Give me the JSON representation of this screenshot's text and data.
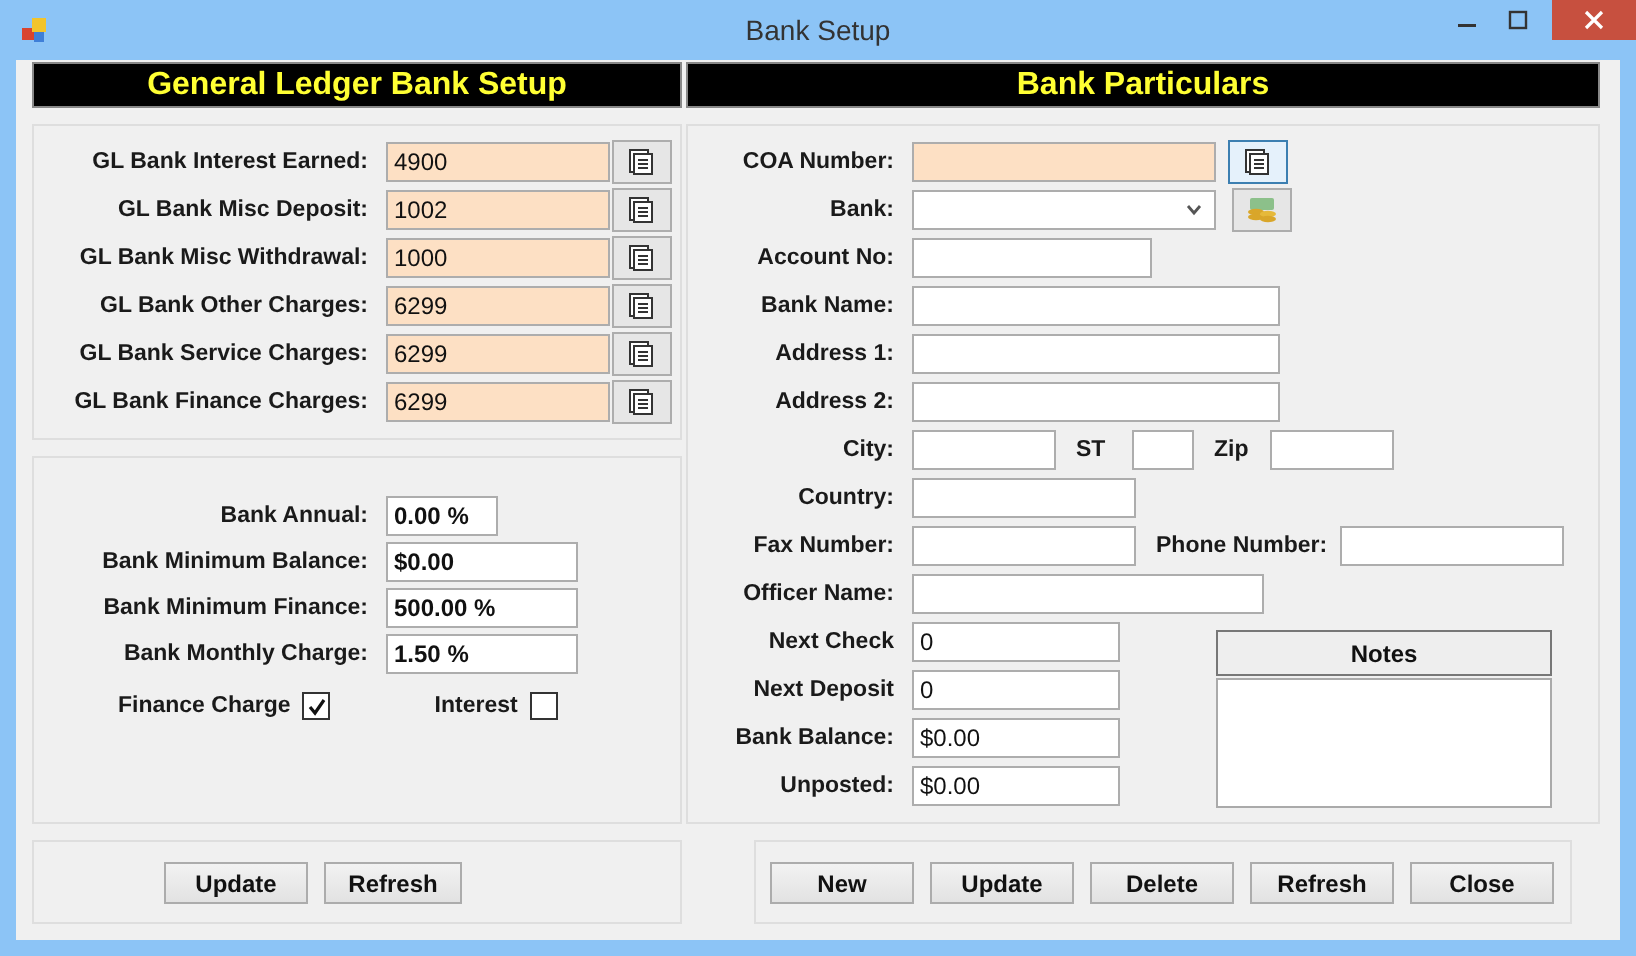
{
  "window": {
    "title": "Bank Setup"
  },
  "gl_setup": {
    "heading": "General Ledger Bank Setup",
    "accounts": [
      {
        "label": "GL Bank Interest Earned:",
        "value": "4900"
      },
      {
        "label": "GL Bank Misc Deposit:",
        "value": "1002"
      },
      {
        "label": "GL Bank Misc Withdrawal:",
        "value": "1000"
      },
      {
        "label": "GL Bank Other Charges:",
        "value": "6299"
      },
      {
        "label": "GL Bank Service Charges:",
        "value": "6299"
      },
      {
        "label": "GL Bank Finance Charges:",
        "value": "6299"
      }
    ],
    "rates": [
      {
        "label": "Bank Annual:",
        "value": "0.00 %"
      },
      {
        "label": "Bank Minimum Balance:",
        "value": "$0.00"
      },
      {
        "label": "Bank Minimum Finance:",
        "value": "500.00 %"
      },
      {
        "label": "Bank Monthly Charge:",
        "value": "1.50 %"
      }
    ],
    "checkboxes": [
      {
        "label": "Finance Charge",
        "checked": true
      },
      {
        "label": "Interest",
        "checked": false
      }
    ],
    "buttons": [
      "Update",
      "Refresh"
    ]
  },
  "particulars": {
    "heading": "Bank Particulars",
    "rows": [
      {
        "label": "COA Number:",
        "kind": "lookup"
      },
      {
        "label": "Bank:",
        "kind": "combo"
      },
      {
        "label": "Account No:",
        "kind": "text"
      },
      {
        "label": "Bank Name:",
        "kind": "text"
      },
      {
        "label": "Address 1:",
        "kind": "text"
      },
      {
        "label": "Address 2:",
        "kind": "text"
      },
      {
        "label": "City:",
        "kind": "text",
        "extras": [
          {
            "caption": "ST"
          },
          {
            "caption": "Zip"
          }
        ]
      },
      {
        "label": "Country:",
        "kind": "text"
      },
      {
        "label": "Fax Number:",
        "kind": "text",
        "extras": [
          {
            "caption": "Phone Number:"
          }
        ]
      },
      {
        "label": "Officer Name:",
        "kind": "text"
      }
    ],
    "counters": [
      {
        "label": "Next Check",
        "value": "0"
      },
      {
        "label": "Next Deposit",
        "value": "0"
      },
      {
        "label": "Bank Balance:",
        "value": "$0.00"
      },
      {
        "label": "Unposted:",
        "value": "$0.00"
      }
    ],
    "notes": {
      "heading": "Notes"
    },
    "buttons": [
      "New",
      "Update",
      "Delete",
      "Refresh",
      "Close"
    ]
  }
}
